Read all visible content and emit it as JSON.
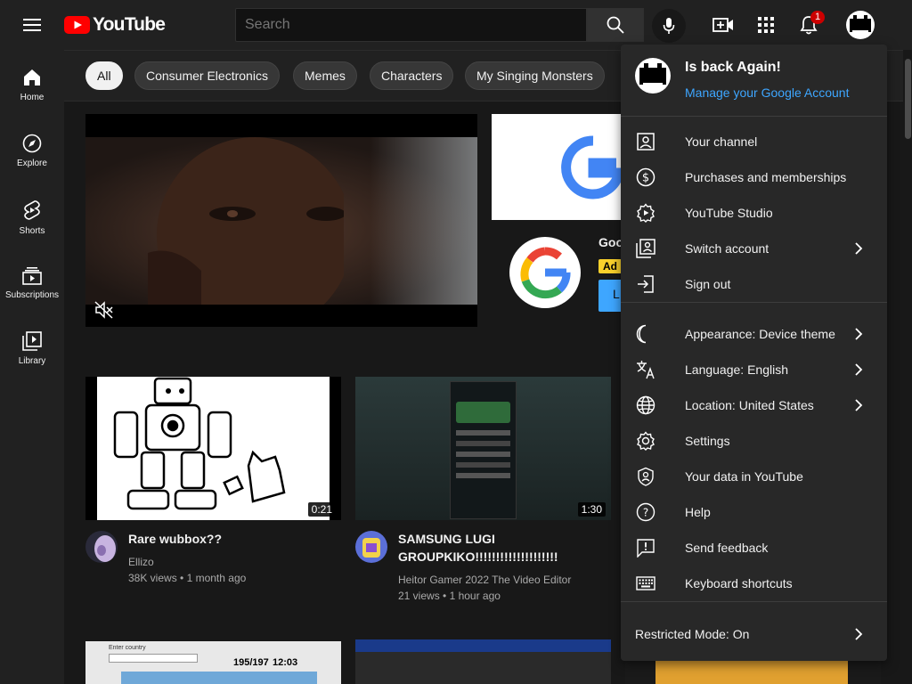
{
  "topbar": {
    "logo_text": "YouTube",
    "search_placeholder": "Search",
    "notification_count": "1"
  },
  "sidebar": {
    "items": [
      {
        "label": "Home",
        "icon": "home-icon"
      },
      {
        "label": "Explore",
        "icon": "compass-icon"
      },
      {
        "label": "Shorts",
        "icon": "shorts-icon"
      },
      {
        "label": "Subscriptions",
        "icon": "subscriptions-icon"
      },
      {
        "label": "Library",
        "icon": "library-icon"
      }
    ]
  },
  "chips": [
    "All",
    "Consumer Electronics",
    "Memes",
    "Characters",
    "My Singing Monsters"
  ],
  "ad": {
    "title": "Goo",
    "badge": "Ad",
    "cta": "L"
  },
  "videos": [
    {
      "title": "Rare wubbox??",
      "channel": "Ellizo",
      "views": "38K views",
      "age": "1 month ago",
      "duration": "0:21"
    },
    {
      "title": "SAMSUNG LUGI GROUPKIKO!!!!!!!!!!!!!!!!!!!!",
      "channel": "Heitor Gamer 2022 The Video Editor",
      "views": "21 views",
      "age": "1 hour ago",
      "duration": "1:30"
    }
  ],
  "thumb_texts": {
    "score": "195/197",
    "time": "12:03",
    "search_label": "Enter country"
  },
  "account_menu": {
    "name": "Is back Again!",
    "manage": "Manage your Google Account",
    "section1": [
      {
        "label": "Your channel",
        "icon": "person-box-icon",
        "chevron": false
      },
      {
        "label": "Purchases and memberships",
        "icon": "dollar-circle-icon",
        "chevron": false
      },
      {
        "label": "YouTube Studio",
        "icon": "studio-gear-icon",
        "chevron": false
      },
      {
        "label": "Switch account",
        "icon": "switch-account-icon",
        "chevron": true
      },
      {
        "label": "Sign out",
        "icon": "sign-out-icon",
        "chevron": false
      }
    ],
    "section2": [
      {
        "label": "Appearance: Device theme",
        "icon": "moon-icon",
        "chevron": true
      },
      {
        "label": "Language: English",
        "icon": "translate-icon",
        "chevron": true
      },
      {
        "label": "Location: United States",
        "icon": "globe-icon",
        "chevron": true
      },
      {
        "label": "Settings",
        "icon": "settings-gear-icon",
        "chevron": false
      },
      {
        "label": "Your data in YouTube",
        "icon": "shield-person-icon",
        "chevron": false
      },
      {
        "label": "Help",
        "icon": "help-circle-icon",
        "chevron": false
      },
      {
        "label": "Send feedback",
        "icon": "feedback-icon",
        "chevron": false
      },
      {
        "label": "Keyboard shortcuts",
        "icon": "keyboard-icon",
        "chevron": false
      }
    ],
    "restricted": "Restricted Mode: On"
  },
  "colors": {
    "brand_red": "#ff0000",
    "link_blue": "#3ea6ff",
    "ad_yellow": "#f9d12c"
  }
}
